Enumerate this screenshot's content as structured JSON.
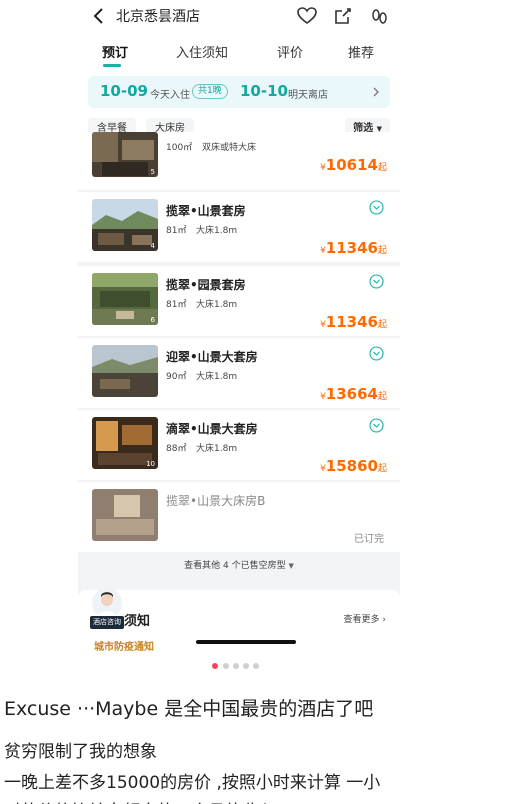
{
  "nav": {
    "back_icon": "chevron-left-icon",
    "title": "北京悉昙酒店",
    "icons": [
      "heart-icon",
      "share-icon",
      "footprint-icon"
    ]
  },
  "tabs": [
    {
      "label": "预订",
      "active": true
    },
    {
      "label": "入住须知",
      "active": false
    },
    {
      "label": "评价",
      "active": false
    },
    {
      "label": "推荐",
      "active": false
    }
  ],
  "date_bar": {
    "checkin_date": "10-09",
    "checkin_label": "今天入住",
    "nights": "共1晚",
    "checkout_date": "10-10",
    "checkout_label": "明天离店"
  },
  "filters": {
    "chips": [
      "含早餐",
      "大床房"
    ],
    "filter_label": "筛选"
  },
  "rooms": [
    {
      "name": "",
      "area": "100㎡",
      "bed": "双床或特大床",
      "price": "10614",
      "thumb_index": "5"
    },
    {
      "name": "揽翠•山景套房",
      "area": "81㎡",
      "bed": "大床1.8m",
      "price": "11346",
      "thumb_index": "4"
    },
    {
      "name": "揽翠•园景套房",
      "area": "81㎡",
      "bed": "大床1.8m",
      "price": "11346",
      "thumb_index": "6"
    },
    {
      "name": "迎翠•山景大套房",
      "area": "90㎡",
      "bed": "大床1.8m",
      "price": "13664",
      "thumb_index": ""
    },
    {
      "name": "滴翠•山景大套房",
      "area": "88㎡",
      "bed": "大床1.8m",
      "price": "15860",
      "thumb_index": "10"
    },
    {
      "name": "揽翠•山景大床房B",
      "status": "已订完"
    }
  ],
  "price_prefix": "¥",
  "price_suffix": "起",
  "more_rooms": "查看其他 4 个已售空房型",
  "notice": {
    "badge": "酒店咨询",
    "title": "须知",
    "view_more": "查看更多",
    "city_notice": "城市防疫通知"
  },
  "carousel": {
    "count": 5,
    "active": 0
  },
  "post": {
    "title": "Excuse ···Maybe 是全中国最贵的酒店了吧",
    "line1": "贫穷限制了我的想象",
    "line2": "一晚上差不多15000的房价 ,按照小时来计算 一小"
  },
  "colors": {
    "accent": "#12b4a8",
    "price": "#ff6a00",
    "notice": "#c8841a",
    "carousel_active": "#f2455a"
  }
}
